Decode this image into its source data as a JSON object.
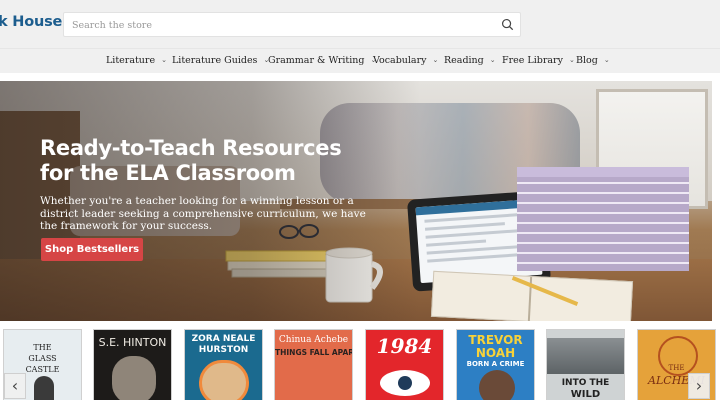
{
  "header": {
    "logo_text": "k House",
    "search_placeholder": "Search the store"
  },
  "nav": {
    "items": [
      {
        "label": "Literature"
      },
      {
        "label": "Literature Guides"
      },
      {
        "label": "Grammar & Writing"
      },
      {
        "label": "Vocabulary"
      },
      {
        "label": "Reading"
      },
      {
        "label": "Free Library"
      },
      {
        "label": "Blog"
      }
    ]
  },
  "hero": {
    "title": "Ready-to-Teach Resources for the ELA Classroom",
    "subtitle": "Whether you're a teacher looking for a winning lesson or a district leader seeking a comprehensive curriculum, we have the framework for your success.",
    "button_label": "Shop Bestsellers"
  },
  "carousel": {
    "books": [
      {
        "line1": "THE",
        "line2": "GLASS",
        "line3": "CASTLE"
      },
      {
        "line1": "S.E. HINTON"
      },
      {
        "line1": "ZORA NEALE",
        "line2": "HURSTON"
      },
      {
        "line1": "Chinua Achebe",
        "line2": "THINGS FALL APART"
      },
      {
        "line1": "1984"
      },
      {
        "line1": "TREVOR",
        "line2": "NOAH",
        "line3": "BORN A CRIME"
      },
      {
        "line1": "INTO THE",
        "line2": "WILD"
      },
      {
        "line1": "THE",
        "line2": "ALCHEMI"
      }
    ]
  },
  "colors": {
    "brand_blue": "#1c5d8e",
    "cta_red": "#d64545"
  }
}
